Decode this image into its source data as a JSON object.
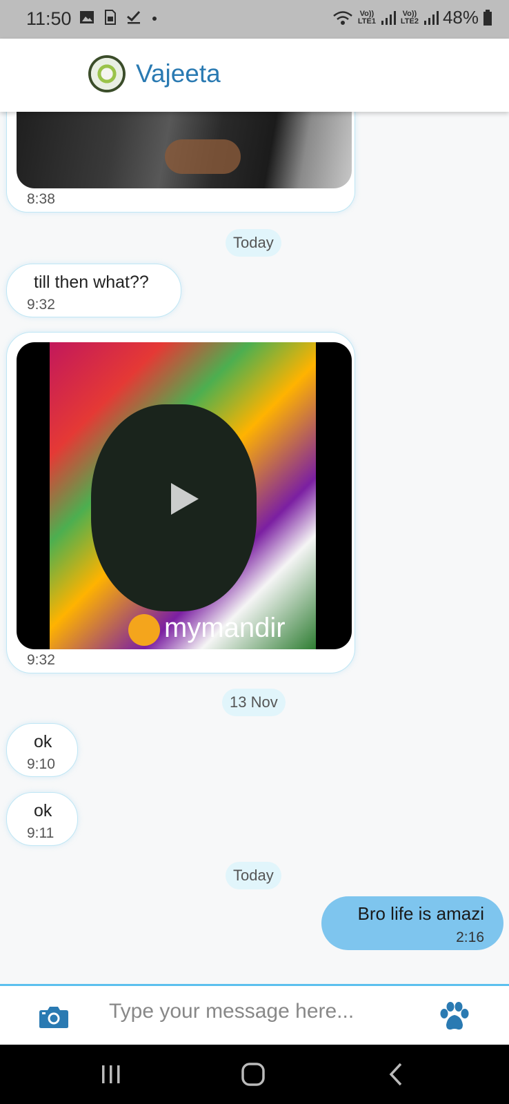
{
  "status_bar": {
    "time": "11:50",
    "lte1": "Vo)) LTE1",
    "lte2": "Vo)) LTE2",
    "battery": "48%",
    "icons": [
      "image-icon",
      "sim-icon",
      "check-icon",
      "dot-icon",
      "wifi-icon",
      "signal-icon",
      "battery-icon"
    ]
  },
  "header": {
    "contact_name": "Vajeeta"
  },
  "messages": [
    {
      "type": "image",
      "time": "8:38"
    },
    {
      "type": "date",
      "label": "Today"
    },
    {
      "type": "text",
      "text": "till then what??",
      "time": "9:32"
    },
    {
      "type": "video",
      "time": "9:32",
      "watermark": "mymandir"
    },
    {
      "type": "date",
      "label": "13 Nov"
    },
    {
      "type": "text",
      "text": "ok",
      "time": "9:10"
    },
    {
      "type": "text",
      "text": "ok",
      "time": "9:11"
    },
    {
      "type": "date",
      "label": "Today"
    },
    {
      "type": "text",
      "outgoing": true,
      "text": "Bro life is amazi",
      "time": "2:16"
    }
  ],
  "input": {
    "placeholder": "Type your message here..."
  },
  "colors": {
    "accent": "#2a7ab2",
    "outgoing_bubble": "#7ec5ee",
    "date_chip": "#e1f5fb",
    "input_border": "#5bc0ee"
  }
}
